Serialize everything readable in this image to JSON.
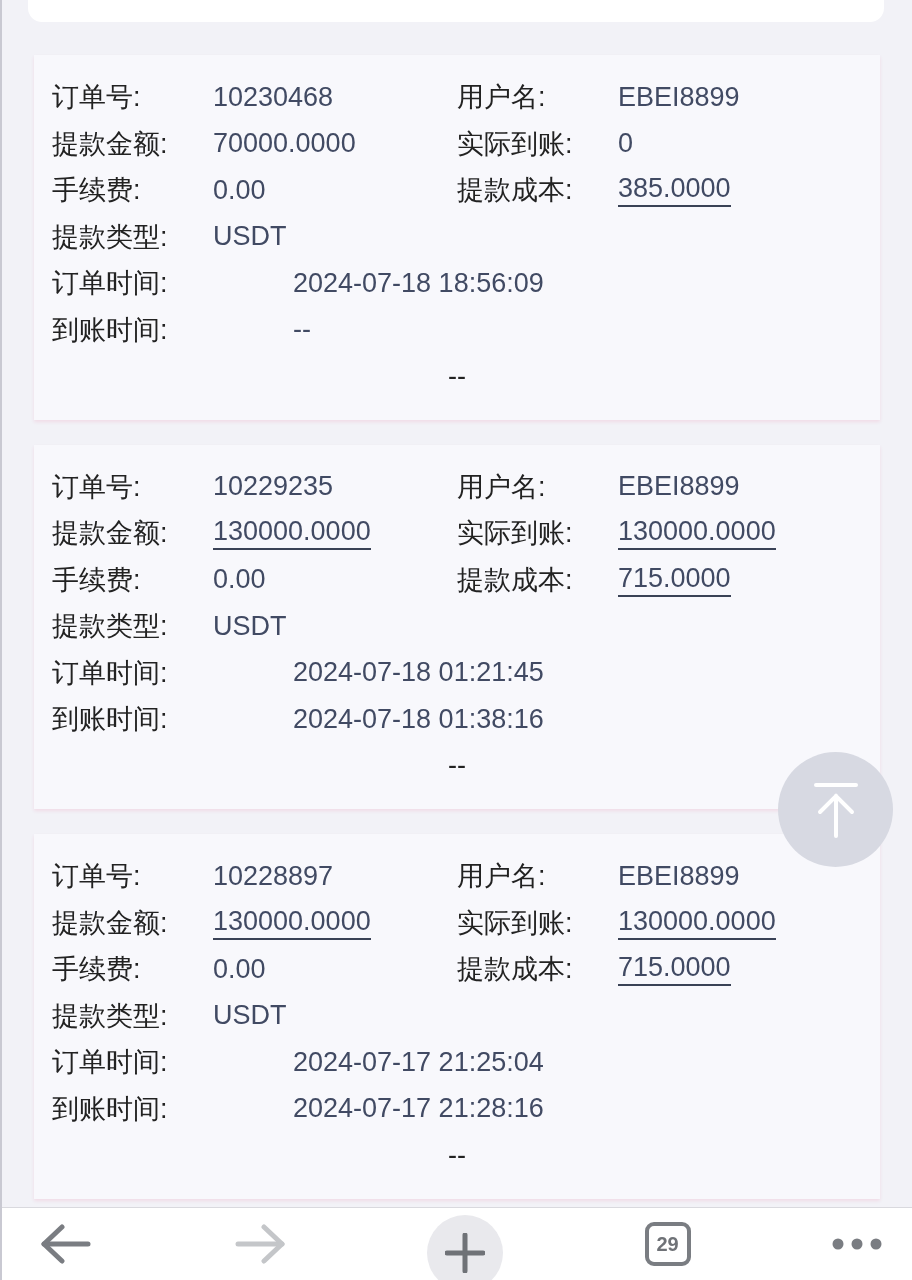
{
  "orders": [
    {
      "rows": [
        {
          "kind": "pair",
          "cells": [
            {
              "label": "订单号:",
              "value": "10230468",
              "underlined": false
            },
            {
              "label": "用户名:",
              "value": "EBEI8899",
              "underlined": false
            }
          ]
        },
        {
          "kind": "pair",
          "cells": [
            {
              "label": "提款金额:",
              "value": "70000.0000",
              "underlined": false
            },
            {
              "label": "实际到账:",
              "value": "0",
              "underlined": false
            }
          ]
        },
        {
          "kind": "pair",
          "cells": [
            {
              "label": "手续费:",
              "value": "0.00",
              "underlined": false
            },
            {
              "label": "提款成本:",
              "value": "385.0000",
              "underlined": true
            }
          ]
        },
        {
          "kind": "pair",
          "cells": [
            {
              "label": "提款类型:",
              "value": "USDT",
              "underlined": false
            }
          ]
        },
        {
          "kind": "time",
          "cells": [
            {
              "label": "订单时间:",
              "value": "2024-07-18 18:56:09",
              "underlined": false
            }
          ]
        },
        {
          "kind": "time",
          "cells": [
            {
              "label": "到账时间:",
              "value": "--",
              "underlined": false
            }
          ]
        }
      ],
      "note": "--"
    },
    {
      "rows": [
        {
          "kind": "pair",
          "cells": [
            {
              "label": "订单号:",
              "value": "10229235",
              "underlined": false
            },
            {
              "label": "用户名:",
              "value": "EBEI8899",
              "underlined": false
            }
          ]
        },
        {
          "kind": "pair",
          "cells": [
            {
              "label": "提款金额:",
              "value": "130000.0000",
              "underlined": true
            },
            {
              "label": "实际到账:",
              "value": "130000.0000",
              "underlined": true
            }
          ]
        },
        {
          "kind": "pair",
          "cells": [
            {
              "label": "手续费:",
              "value": "0.00",
              "underlined": false
            },
            {
              "label": "提款成本:",
              "value": "715.0000",
              "underlined": true
            }
          ]
        },
        {
          "kind": "pair",
          "cells": [
            {
              "label": "提款类型:",
              "value": "USDT",
              "underlined": false
            }
          ]
        },
        {
          "kind": "time",
          "cells": [
            {
              "label": "订单时间:",
              "value": "2024-07-18 01:21:45",
              "underlined": false
            }
          ]
        },
        {
          "kind": "time",
          "cells": [
            {
              "label": "到账时间:",
              "value": "2024-07-18 01:38:16",
              "underlined": false
            }
          ]
        }
      ],
      "note": "--"
    },
    {
      "rows": [
        {
          "kind": "pair",
          "cells": [
            {
              "label": "订单号:",
              "value": "10228897",
              "underlined": false
            },
            {
              "label": "用户名:",
              "value": "EBEI8899",
              "underlined": false
            }
          ]
        },
        {
          "kind": "pair",
          "cells": [
            {
              "label": "提款金额:",
              "value": "130000.0000",
              "underlined": true
            },
            {
              "label": "实际到账:",
              "value": "130000.0000",
              "underlined": true
            }
          ]
        },
        {
          "kind": "pair",
          "cells": [
            {
              "label": "手续费:",
              "value": "0.00",
              "underlined": false
            },
            {
              "label": "提款成本:",
              "value": "715.0000",
              "underlined": true
            }
          ]
        },
        {
          "kind": "pair",
          "cells": [
            {
              "label": "提款类型:",
              "value": "USDT",
              "underlined": false
            }
          ]
        },
        {
          "kind": "time",
          "cells": [
            {
              "label": "订单时间:",
              "value": "2024-07-17 21:25:04",
              "underlined": false
            }
          ]
        },
        {
          "kind": "time",
          "cells": [
            {
              "label": "到账时间:",
              "value": "2024-07-17 21:28:16",
              "underlined": false
            }
          ]
        }
      ],
      "note": "--"
    }
  ],
  "toolbar": {
    "buttons": [
      {
        "kind": "back",
        "disabled": false
      },
      {
        "kind": "forward",
        "disabled": true
      },
      {
        "kind": "new-tab"
      },
      {
        "kind": "tabs",
        "label": "29"
      },
      {
        "kind": "more"
      }
    ]
  }
}
